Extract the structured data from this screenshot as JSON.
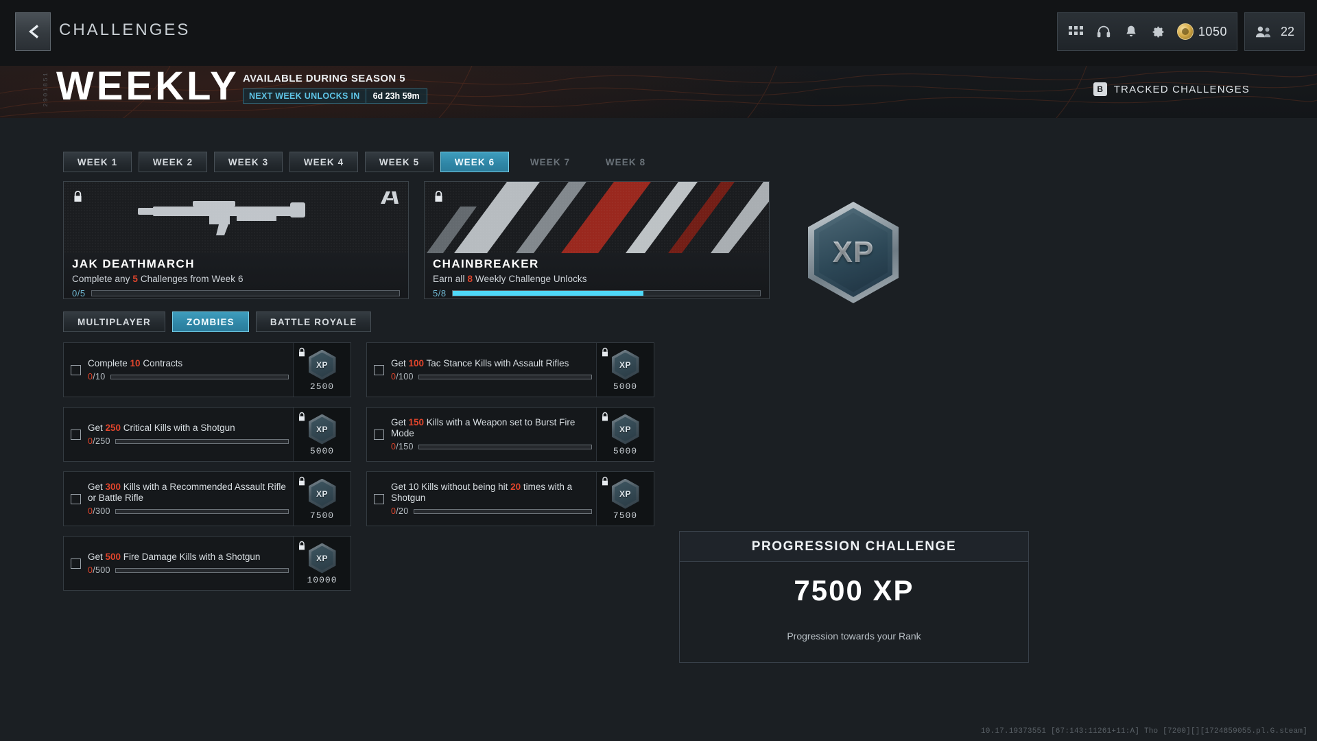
{
  "header": {
    "title": "CHALLENGES",
    "back_icon": "chevron-left-icon",
    "icons": [
      "grid-apps-icon",
      "headset-icon",
      "bell-icon",
      "gear-icon"
    ],
    "currency": "1050",
    "friends_count": "22"
  },
  "hero": {
    "title": "WEEKLY",
    "side_code": "2901851",
    "subtitle": "AVAILABLE DURING SEASON 5",
    "timer_label": "NEXT WEEK UNLOCKS IN",
    "timer_value": "6d 23h 59m",
    "tracked_key": "B",
    "tracked_label": "TRACKED CHALLENGES"
  },
  "week_tabs": [
    {
      "label": "WEEK 1",
      "state": "normal"
    },
    {
      "label": "WEEK 2",
      "state": "normal"
    },
    {
      "label": "WEEK 3",
      "state": "normal"
    },
    {
      "label": "WEEK 4",
      "state": "normal"
    },
    {
      "label": "WEEK 5",
      "state": "normal"
    },
    {
      "label": "WEEK 6",
      "state": "active"
    },
    {
      "label": "WEEK 7",
      "state": "locked"
    },
    {
      "label": "WEEK 8",
      "state": "locked"
    }
  ],
  "rewards": [
    {
      "name": "JAK DEATHMARCH",
      "desc_pre": "Complete any ",
      "desc_num": "5",
      "desc_post": " Challenges from Week 6",
      "progress_text": "0/5",
      "progress_pct": 0,
      "art": "weapon-silhouette",
      "locked": true
    },
    {
      "name": "CHAINBREAKER",
      "desc_pre": "Earn all ",
      "desc_num": "8",
      "desc_post": " Weekly Challenge Unlocks",
      "progress_text": "5/8",
      "progress_pct": 62,
      "art": "camo-stripes",
      "locked": true
    }
  ],
  "mode_tabs": [
    {
      "label": "MULTIPLAYER",
      "state": "normal"
    },
    {
      "label": "ZOMBIES",
      "state": "active"
    },
    {
      "label": "BATTLE ROYALE",
      "state": "normal"
    }
  ],
  "challenges": [
    {
      "desc_pre": "Complete ",
      "desc_num": "10",
      "desc_post": " Contracts",
      "frac_cur": "0",
      "frac_den": "/10",
      "progress_pct": 0,
      "xp_label": "XP",
      "xp_amount": "2500",
      "locked": true
    },
    {
      "desc_pre": "Get ",
      "desc_num": "100",
      "desc_post": " Tac Stance Kills with Assault Rifles",
      "frac_cur": "0",
      "frac_den": "/100",
      "progress_pct": 0,
      "xp_label": "XP",
      "xp_amount": "5000",
      "locked": true
    },
    {
      "desc_pre": "Get ",
      "desc_num": "250",
      "desc_post": " Critical Kills with a Shotgun",
      "frac_cur": "0",
      "frac_den": "/250",
      "progress_pct": 0,
      "xp_label": "XP",
      "xp_amount": "5000",
      "locked": true
    },
    {
      "desc_pre": "Get ",
      "desc_num": "150",
      "desc_post": " Kills with a Weapon set to Burst Fire Mode",
      "frac_cur": "0",
      "frac_den": "/150",
      "progress_pct": 0,
      "xp_label": "XP",
      "xp_amount": "5000",
      "locked": true
    },
    {
      "desc_pre": "Get ",
      "desc_num": "300",
      "desc_post": " Kills with a Recommended Assault Rifle or Battle Rifle",
      "frac_cur": "0",
      "frac_den": "/300",
      "progress_pct": 0,
      "xp_label": "XP",
      "xp_amount": "7500",
      "locked": true
    },
    {
      "desc_pre": "Get 10 Kills without being hit ",
      "desc_num": "20",
      "desc_post": " times with a Shotgun",
      "frac_cur": "0",
      "frac_den": "/20",
      "progress_pct": 0,
      "xp_label": "XP",
      "xp_amount": "7500",
      "locked": true
    },
    {
      "desc_pre": "Get ",
      "desc_num": "500",
      "desc_post": " Fire Damage Kills with a Shotgun",
      "frac_cur": "0",
      "frac_den": "/500",
      "progress_pct": 0,
      "xp_label": "XP",
      "xp_amount": "10000",
      "locked": true
    }
  ],
  "right_panel": {
    "badge_label": "XP",
    "panel_title": "PROGRESSION CHALLENGE",
    "panel_xp": "7500 XP",
    "panel_note": "Progression towards your Rank"
  },
  "build_stamp": "10.17.19373551 [67:143:11261+11:A] Tho [7200][][1724859055.pl.G.steam]",
  "colors": {
    "accent_cyan": "#4fd8f8",
    "tab_active": "#2f86a6",
    "number_red": "#e0452c",
    "panel_bg": "#15181b"
  }
}
